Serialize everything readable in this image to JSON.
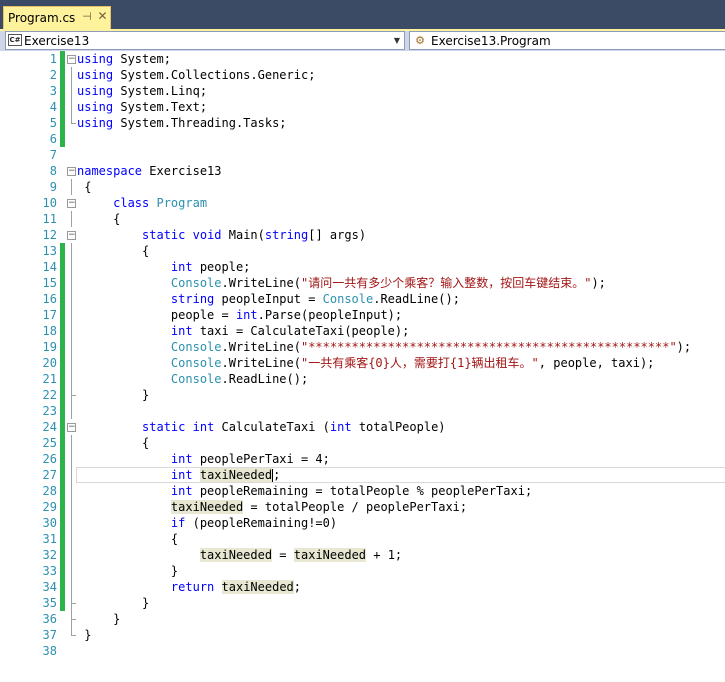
{
  "tab": {
    "title": "Program.cs",
    "pin_glyph": "⊣",
    "close_glyph": "✕"
  },
  "navbar": {
    "project": "Exercise13",
    "scope": "Exercise13.Program",
    "project_icon_text": "C#"
  },
  "lines": [
    {
      "n": "1",
      "ch": true,
      "fold": "minus",
      "code": "using System;"
    },
    {
      "n": "2",
      "ch": true,
      "code": "using System.Collections.Generic;"
    },
    {
      "n": "3",
      "ch": true,
      "code": "using System.Linq;"
    },
    {
      "n": "4",
      "ch": true,
      "code": "using System.Text;"
    },
    {
      "n": "5",
      "ch": true,
      "code": "using System.Threading.Tasks;"
    },
    {
      "n": "6",
      "ch": true,
      "code": ""
    },
    {
      "n": "7",
      "ch": false,
      "code": ""
    },
    {
      "n": "8",
      "ch": false,
      "fold": "minus",
      "code": "namespace Exercise13"
    },
    {
      "n": "9",
      "ch": false,
      "code": " {"
    },
    {
      "n": "10",
      "ch": false,
      "fold": "minus",
      "code": "     class Program"
    },
    {
      "n": "11",
      "ch": false,
      "code": "     {"
    },
    {
      "n": "12",
      "ch": false,
      "fold": "minus",
      "code": "         static void Main(string[] args)"
    },
    {
      "n": "13",
      "ch": true,
      "code": "         {"
    },
    {
      "n": "14",
      "ch": true,
      "code": "             int people;"
    },
    {
      "n": "15",
      "ch": true,
      "code": "             Console.WriteLine(\"请问一共有多少个乘客？输入整数，按回车键结束。\");"
    },
    {
      "n": "16",
      "ch": true,
      "code": "             string peopleInput = Console.ReadLine();"
    },
    {
      "n": "17",
      "ch": true,
      "code": "             people = int.Parse(peopleInput);"
    },
    {
      "n": "18",
      "ch": true,
      "code": "             int taxi = CalculateTaxi(people);"
    },
    {
      "n": "19",
      "ch": true,
      "code": "             Console.WriteLine(\"**************************************************\");"
    },
    {
      "n": "20",
      "ch": true,
      "code": "             Console.WriteLine(\"一共有乘客{0}人，需要打{1}辆出租车。\", people, taxi);"
    },
    {
      "n": "21",
      "ch": true,
      "code": "             Console.ReadLine();"
    },
    {
      "n": "22",
      "ch": true,
      "code": "         }"
    },
    {
      "n": "23",
      "ch": true,
      "code": ""
    },
    {
      "n": "24",
      "ch": true,
      "fold": "minus",
      "code": "         static int CalculateTaxi (int totalPeople)"
    },
    {
      "n": "25",
      "ch": true,
      "code": "         {"
    },
    {
      "n": "26",
      "ch": true,
      "code": "             int peoplePerTaxi = 4;"
    },
    {
      "n": "27",
      "ch": true,
      "code": "             int taxiNeeded;",
      "current": true
    },
    {
      "n": "28",
      "ch": true,
      "code": "             int peopleRemaining = totalPeople % peoplePerTaxi;"
    },
    {
      "n": "29",
      "ch": true,
      "code": "             taxiNeeded = totalPeople / peoplePerTaxi;"
    },
    {
      "n": "30",
      "ch": true,
      "code": "             if (peopleRemaining!=0)"
    },
    {
      "n": "31",
      "ch": true,
      "code": "             {"
    },
    {
      "n": "32",
      "ch": true,
      "code": "                 taxiNeeded = taxiNeeded + 1;"
    },
    {
      "n": "33",
      "ch": true,
      "code": "             }"
    },
    {
      "n": "34",
      "ch": true,
      "code": "             return taxiNeeded;"
    },
    {
      "n": "35",
      "ch": true,
      "code": "         }"
    },
    {
      "n": "36",
      "ch": false,
      "code": "     }"
    },
    {
      "n": "37",
      "ch": false,
      "code": " }"
    },
    {
      "n": "38",
      "ch": false,
      "code": ""
    }
  ],
  "colors": {
    "keyword": "#0000FF",
    "type": "#2B91AF",
    "string": "#A31515",
    "line_number": "#2B91AF",
    "change_bar": "#2CB34A",
    "tab_active": "#FFF29D",
    "chrome": "#3B4B66"
  }
}
